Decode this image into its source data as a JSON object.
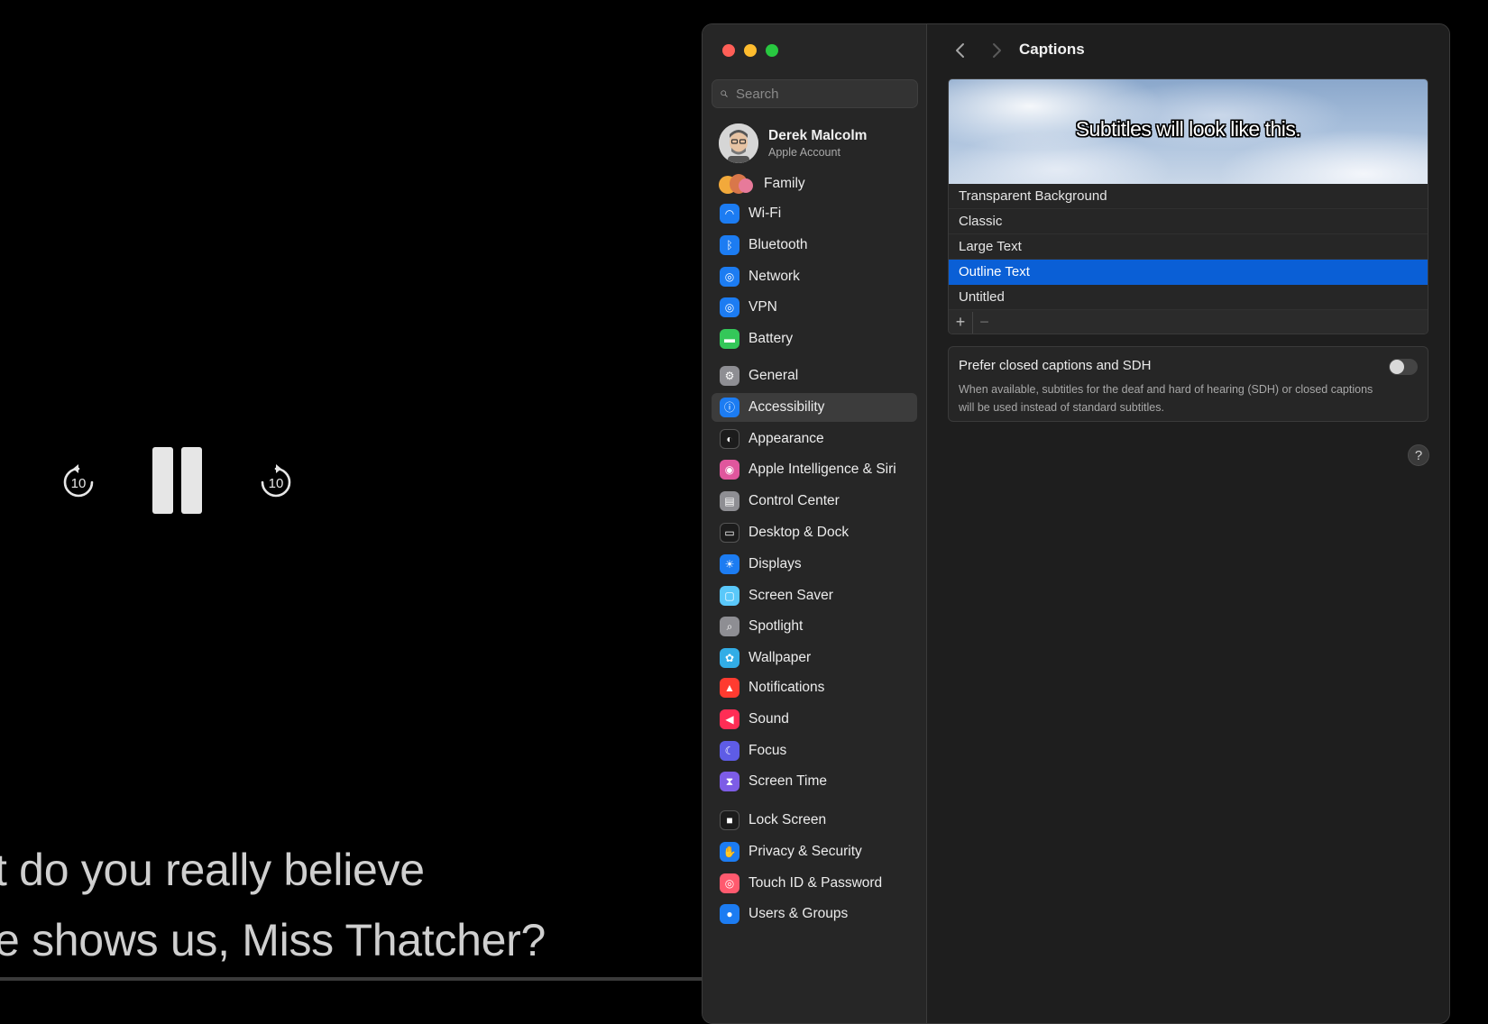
{
  "player": {
    "skip_back_label": "10",
    "skip_forward_label": "10",
    "subtitle_line_1": "t do you really believe",
    "subtitle_line_2": "e shows us, Miss Thatcher?"
  },
  "window": {
    "search": {
      "placeholder": "Search"
    },
    "account": {
      "name": "Derek Malcolm",
      "subtitle": "Apple Account"
    },
    "family_label": "Family",
    "sidebar": {
      "items": [
        {
          "label": "Wi-Fi",
          "icon": "wifi-icon",
          "color": "#1c7cf2"
        },
        {
          "label": "Bluetooth",
          "icon": "bluetooth-icon",
          "color": "#1c7cf2"
        },
        {
          "label": "Network",
          "icon": "globe-icon",
          "color": "#1c7cf2"
        },
        {
          "label": "VPN",
          "icon": "vpn-globe-icon",
          "color": "#1c7cf2"
        },
        {
          "label": "Battery",
          "icon": "battery-icon",
          "color": "#34c759"
        },
        {
          "label": "General",
          "icon": "gear-icon",
          "color": "#8e8e93"
        },
        {
          "label": "Accessibility",
          "icon": "accessibility-icon",
          "color": "#1c7cf2",
          "selected": true
        },
        {
          "label": "Appearance",
          "icon": "appearance-icon",
          "color": "#1c1c1c"
        },
        {
          "label": "Apple Intelligence & Siri",
          "icon": "siri-icon",
          "color": "#e0569d"
        },
        {
          "label": "Control Center",
          "icon": "control-center-icon",
          "color": "#8e8e93"
        },
        {
          "label": "Desktop & Dock",
          "icon": "dock-icon",
          "color": "#1c1c1c"
        },
        {
          "label": "Displays",
          "icon": "sun-icon",
          "color": "#1c7cf2"
        },
        {
          "label": "Screen Saver",
          "icon": "screen-saver-icon",
          "color": "#5ac8fa"
        },
        {
          "label": "Spotlight",
          "icon": "magnifier-icon",
          "color": "#8e8e93"
        },
        {
          "label": "Wallpaper",
          "icon": "flower-icon",
          "color": "#32ade6"
        },
        {
          "label": "Notifications",
          "icon": "bell-icon",
          "color": "#ff3b30"
        },
        {
          "label": "Sound",
          "icon": "speaker-icon",
          "color": "#ff2d55"
        },
        {
          "label": "Focus",
          "icon": "moon-icon",
          "color": "#5e5ce6"
        },
        {
          "label": "Screen Time",
          "icon": "hourglass-icon",
          "color": "#7d5ce6"
        },
        {
          "label": "Lock Screen",
          "icon": "lock-icon",
          "color": "#1c1c1c"
        },
        {
          "label": "Privacy & Security",
          "icon": "hand-icon",
          "color": "#1c7cf2"
        },
        {
          "label": "Touch ID & Password",
          "icon": "fingerprint-icon",
          "color": "#ff5a6e"
        },
        {
          "label": "Users & Groups",
          "icon": "users-icon",
          "color": "#1c7cf2"
        }
      ]
    },
    "content": {
      "title": "Captions",
      "preview_text": "Subtitles will look like this.",
      "styles": [
        {
          "label": "Transparent Background"
        },
        {
          "label": "Classic"
        },
        {
          "label": "Large Text"
        },
        {
          "label": "Outline Text",
          "selected": true
        },
        {
          "label": "Untitled"
        }
      ],
      "add_label": "+",
      "remove_label": "−",
      "sdh": {
        "title": "Prefer closed captions and SDH",
        "description": "When available, subtitles for the deaf and hard of hearing (SDH) or closed captions will be used instead of standard subtitles.",
        "enabled": false
      },
      "help_label": "?"
    },
    "colors": {
      "selection": "#0a5fd6",
      "accent": "#1c7cf2"
    }
  }
}
